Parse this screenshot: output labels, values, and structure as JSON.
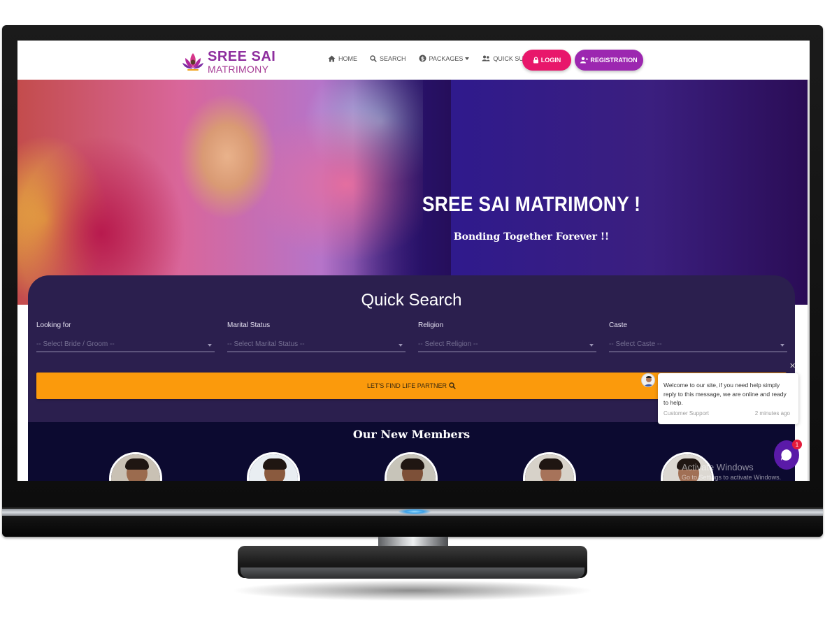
{
  "site": {
    "logo_line1": "SREE SAI",
    "logo_line2": "MATRIMONY"
  },
  "nav": {
    "items": [
      {
        "label": "HOME",
        "icon": "home-icon"
      },
      {
        "label": "SEARCH",
        "icon": "search-icon"
      },
      {
        "label": "PACKAGES",
        "icon": "dollar-icon",
        "dropdown": true
      },
      {
        "label": "QUICK SUPPORT",
        "icon": "users-icon",
        "dropdown": true
      }
    ],
    "login_label": "LOGIN",
    "register_label": "REGISTRATION"
  },
  "hero": {
    "title": "SREE SAI MATRIMONY !",
    "subtitle": "Bonding Together Forever !!"
  },
  "quick_search": {
    "title": "Quick Search",
    "fields": [
      {
        "label": "Looking for",
        "placeholder": "-- Select Bride / Groom --"
      },
      {
        "label": "Marital Status",
        "placeholder": "-- Select Marital Status --"
      },
      {
        "label": "Religion",
        "placeholder": "-- Select Religion --"
      },
      {
        "label": "Caste",
        "placeholder": "-- Select Caste --"
      }
    ],
    "button_label": "LET'S FIND LIFE PARTNER"
  },
  "members": {
    "title": "Our New Members"
  },
  "chat": {
    "message": "Welcome to our site, if you need help simply reply to this message, we are online and ready to help.",
    "sender": "Customer Support",
    "time": "2 minutes ago",
    "badge_count": "1"
  },
  "watermark": {
    "line1": "Activate Windows",
    "line2": "Go to Settings to activate Windows."
  },
  "colors": {
    "login": "#e8176b",
    "register": "#9c27b0",
    "search_panel": "#2b1f4e",
    "find_button": "#fb9a0c",
    "members_bg": "#0c0a30"
  }
}
